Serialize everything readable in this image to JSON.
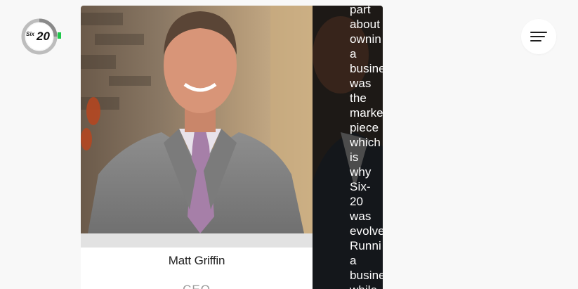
{
  "logo": {
    "text": "Six·20",
    "icon": "six20-logo"
  },
  "menu": {
    "icon": "hamburger-menu-icon"
  },
  "team_card": {
    "name": "Matt Griffin",
    "role": "CEO"
  },
  "bio_card": {
    "text_lines": [
      "part",
      "about",
      "ownin",
      "a",
      "busine",
      "was",
      "the",
      "marke",
      "piece",
      "which",
      "is",
      "why",
      "Six-",
      "20",
      "was",
      "evolve",
      "Runni",
      "a",
      "busine",
      "while"
    ]
  },
  "colors": {
    "background": "#f8f8f8",
    "accent_green": "#1ec84a",
    "text_dark": "#222222"
  }
}
